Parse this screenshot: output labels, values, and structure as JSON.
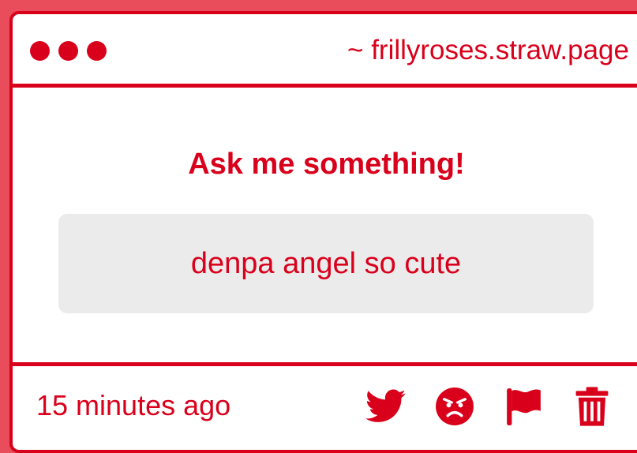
{
  "header": {
    "url": "~ frillyroses.straw.page"
  },
  "question": {
    "prompt": "Ask me something!",
    "answer": "denpa angel so cute"
  },
  "footer": {
    "timestamp": "15 minutes ago",
    "actions": [
      "twitter-icon",
      "angry-face-icon",
      "flag-icon",
      "trash-icon"
    ]
  },
  "colors": {
    "accent": "#d9001b",
    "background": "#e94d5c",
    "answer_box": "#ecebec"
  }
}
